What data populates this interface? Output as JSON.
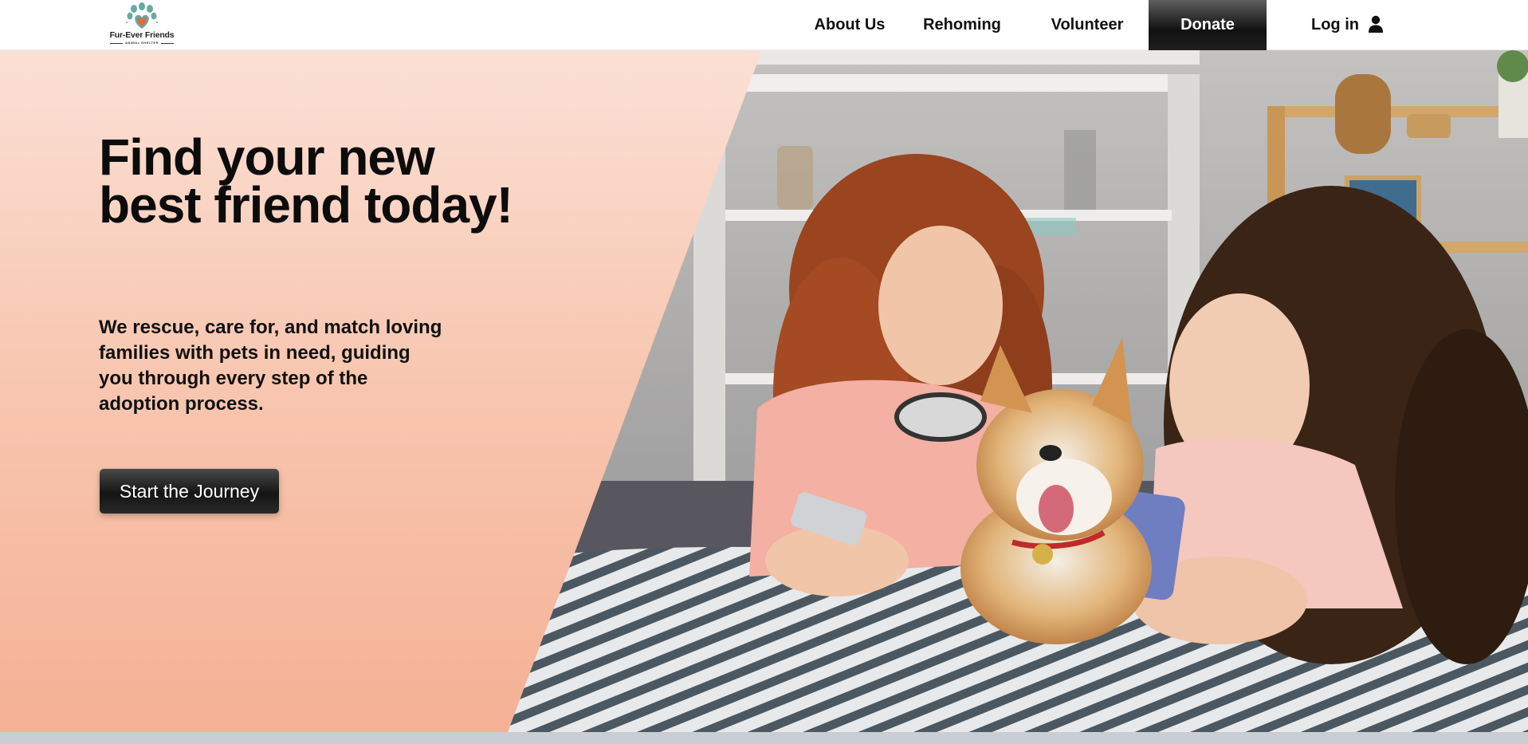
{
  "brand": {
    "name": "Fur-Ever Friends",
    "tagline": "ANIMAL SHELTER",
    "logo_icon": "paw-heart-icon",
    "colors": {
      "paw": "#6aa9a3",
      "heart": "#d96a4a"
    }
  },
  "nav": {
    "items": [
      {
        "label": "About Us"
      },
      {
        "label": "Rehoming"
      },
      {
        "label": "Volunteer"
      },
      {
        "label": "Donate"
      }
    ],
    "login_label": "Log in",
    "login_icon": "user-icon"
  },
  "hero": {
    "headline": "Find your new best friend today!",
    "description": "We rescue, care for, and match loving families with pets in need, guiding you through every step of the adoption process.",
    "cta_label": "Start the Journey",
    "image_alt": "two-women-with-shiba-inu-photo",
    "colors": {
      "panel_top": "#fbe0d6",
      "panel_bottom": "#f5b195",
      "button": "#1a1a1a"
    }
  }
}
